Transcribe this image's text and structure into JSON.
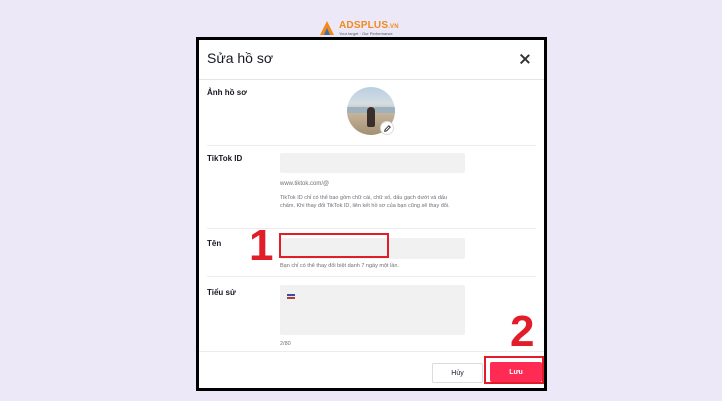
{
  "logo": {
    "brand": "ADSPLUS",
    "suffix": ".VN",
    "tagline": "Your target · Our Performance"
  },
  "modal": {
    "title": "Sửa hồ sơ",
    "close_icon": "close-icon"
  },
  "profile_photo": {
    "label": "Ảnh hồ sơ",
    "edit_icon": "pencil-icon"
  },
  "tiktok_id": {
    "label": "TikTok ID",
    "value": "",
    "url_prefix": "www.tiktok.com/@",
    "helper": "TikTok ID chỉ có thể bao gồm chữ cái, chữ số, dấu gạch dưới và dấu chấm. Khi thay đổi TikTok ID, liên kết hồ sơ của bạn cũng sẽ thay đổi."
  },
  "name": {
    "label": "Tên",
    "value": "",
    "helper": "Bạn chỉ có thể thay đổi biệt danh 7 ngày một lần."
  },
  "bio": {
    "label": "Tiểu sử",
    "value": "",
    "counter": "2/80"
  },
  "buttons": {
    "cancel": "Hủy",
    "save": "Lưu"
  },
  "annotations": {
    "step1": "1",
    "step2": "2"
  },
  "colors": {
    "accent": "#fe2c55",
    "annotation": "#e11d2a",
    "background": "#ece8f7"
  }
}
